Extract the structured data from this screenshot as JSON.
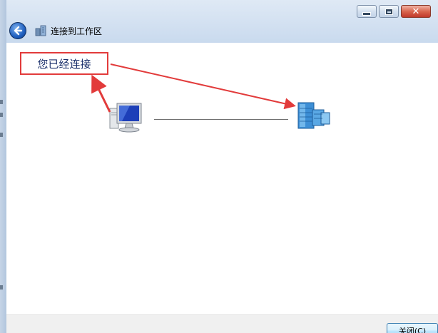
{
  "window": {
    "title": "连接到工作区",
    "caption": {
      "minimize_icon": "minimize-icon",
      "maximize_icon": "maximize-icon",
      "close_icon": "close-icon"
    }
  },
  "nav": {
    "back_icon": "back-arrow-icon",
    "app_icon": "workspace-icon"
  },
  "content": {
    "annotation_text": "您已经连接",
    "computer_icon": "computer-icon",
    "network_icon": "network-server-icon",
    "annotation_color": "#e23b3b"
  },
  "footer": {
    "close_button_label": "关闭(C)"
  }
}
